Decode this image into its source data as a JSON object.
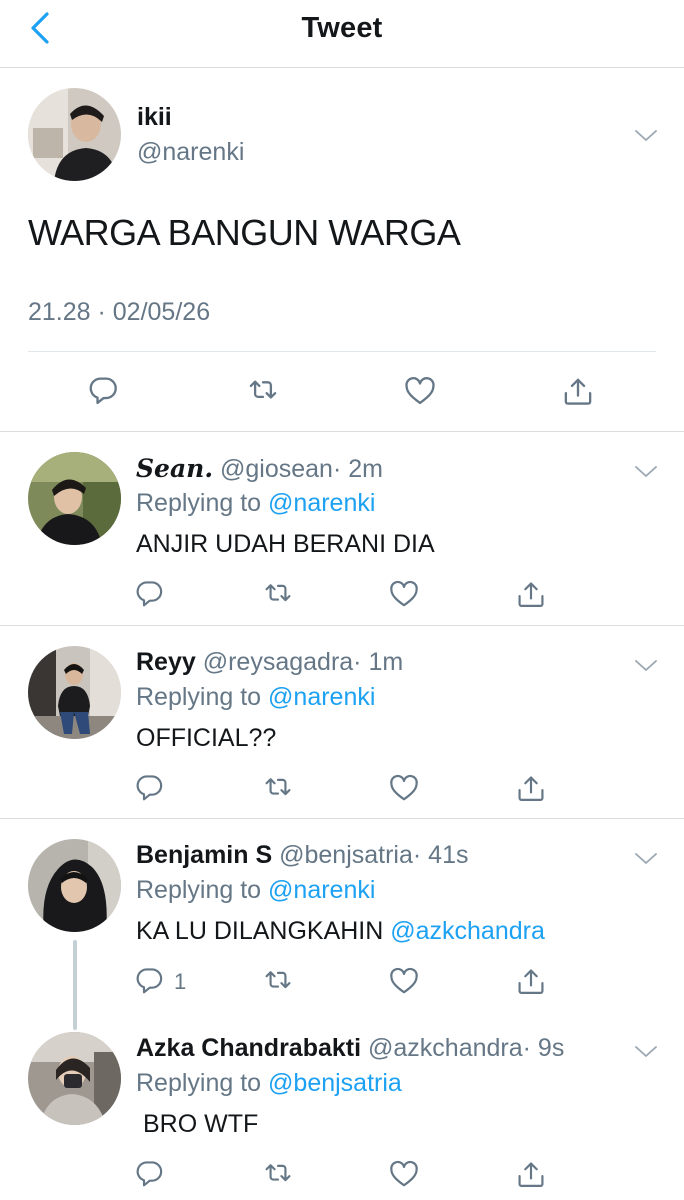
{
  "header": {
    "title": "Tweet"
  },
  "tweet": {
    "name": "ikii",
    "handle": "@narenki",
    "text": "WARGA BANGUN WARGA",
    "meta": "21.28 · 02/05/26"
  },
  "replies": [
    {
      "name": "Sean.",
      "handle": "@giosean",
      "time": "· 2m",
      "replying_label": "Replying to",
      "replying_to": "@narenki",
      "text": "ANJIR UDAH BERANI DIA",
      "mention": "",
      "reply_count": ""
    },
    {
      "name": "Reyy",
      "handle": "@reysagadra",
      "time": "· 1m",
      "replying_label": "Replying to",
      "replying_to": "@narenki",
      "text": "OFFICIAL??",
      "mention": "",
      "reply_count": ""
    },
    {
      "name": "Benjamin S",
      "handle": "@benjsatria",
      "time": "· 41s",
      "replying_label": "Replying to",
      "replying_to": "@narenki",
      "text": "KA LU DILANGKAHIN ",
      "mention": "@azkchandra",
      "reply_count": "1"
    },
    {
      "name": "Azka Chandrabakti",
      "handle": "@azkchandra",
      "time": "· 9s",
      "replying_label": "Replying to",
      "replying_to": "@benjsatria",
      "text": "BRO WTF",
      "mention": "",
      "reply_count": ""
    }
  ],
  "colors": {
    "accent": "#1da1f2",
    "muted": "#657786",
    "divider": "#d9dde0"
  },
  "icons": [
    "chevron-left-icon",
    "chevron-down-icon",
    "reply-icon",
    "retweet-icon",
    "like-icon",
    "share-icon"
  ]
}
